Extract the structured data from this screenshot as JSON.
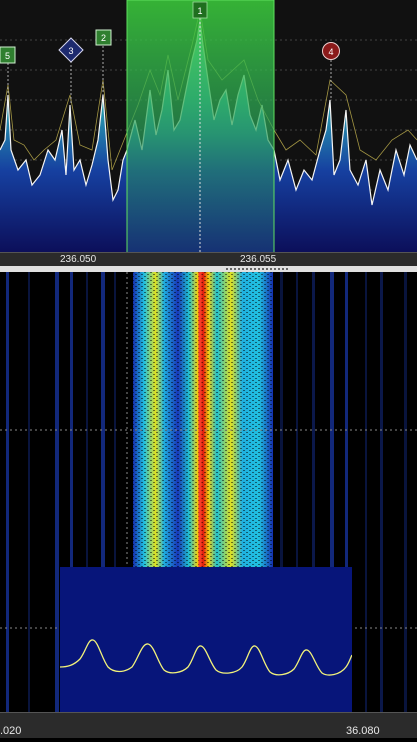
{
  "spectrum": {
    "scale_labels": [
      "236.050",
      "236.055"
    ]
  },
  "markers": [
    {
      "label": "1",
      "shape": "tab",
      "color": "#1f6f1f"
    },
    {
      "label": "2",
      "shape": "square",
      "color": "#2f7f2f"
    },
    {
      "label": "3",
      "shape": "diamond",
      "color": "#1d2a6e"
    },
    {
      "label": "4",
      "shape": "circle",
      "color": "#8b1a1a"
    },
    {
      "label": "5",
      "shape": "square",
      "color": "#2f7f2f"
    }
  ],
  "waterfall": {
    "bottom_labels": [
      ".020",
      "36.080"
    ]
  },
  "colors": {
    "passband": "#2ec02e",
    "spectrum_top": "#3fc8c8",
    "spectrum_bottom": "#141c8a",
    "scope_bg": "#07157a",
    "scope_trace": "#f2f27a"
  }
}
